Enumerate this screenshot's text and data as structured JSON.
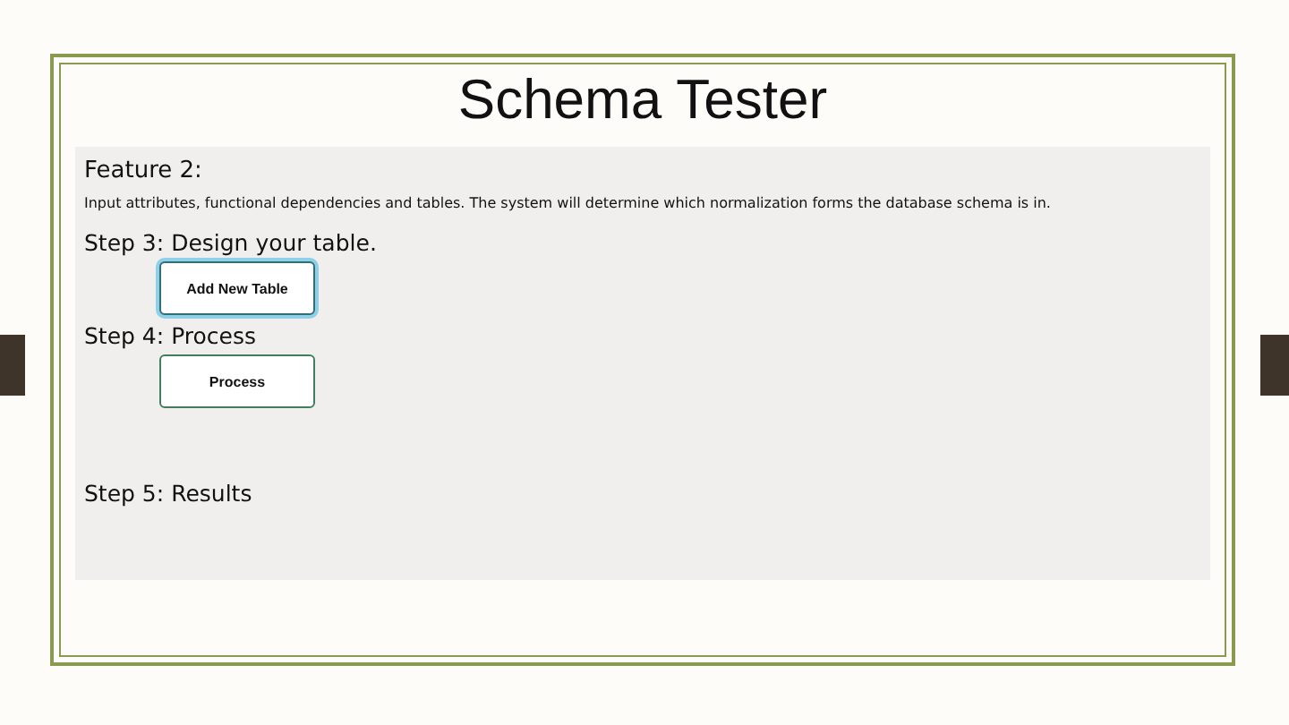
{
  "slide": {
    "title": "Schema Tester"
  },
  "app": {
    "feature_heading": "Feature 2:",
    "description": "Input attributes, functional dependencies and tables. The system will determine which normalization forms the database schema is in.",
    "steps": [
      {
        "label": "Step 3: Design your table.",
        "button": {
          "label": "Add New Table",
          "focused": true
        }
      },
      {
        "label": "Step 4: Process",
        "button": {
          "label": "Process",
          "focused": false
        }
      },
      {
        "label": "Step 5: Results"
      }
    ]
  }
}
